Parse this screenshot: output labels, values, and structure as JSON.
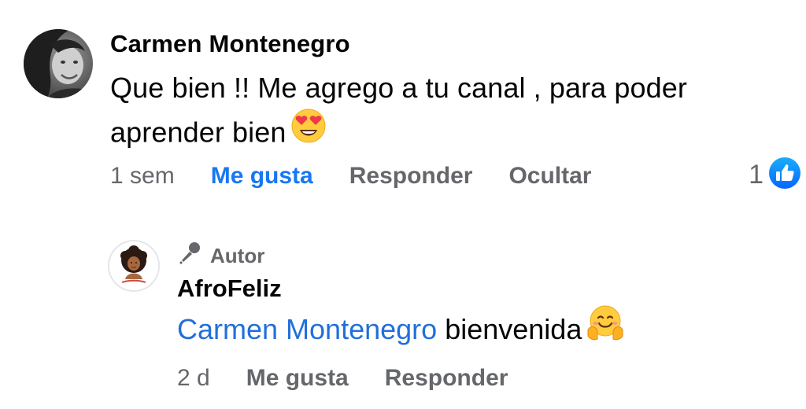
{
  "comment": {
    "author": "Carmen Montenegro",
    "text": "Que bien !! Me agrego a tu canal , para poder aprender bien",
    "emoji": "heart-eyes-emoji",
    "timestamp": "1 sem",
    "actions": {
      "like": "Me gusta",
      "reply": "Responder",
      "hide": "Ocultar"
    },
    "liked": true,
    "reaction_count": "1",
    "reaction_icon": "like-thumb-icon"
  },
  "reply": {
    "badge": "Autor",
    "badge_icon": "microphone-icon",
    "author": "AfroFeliz",
    "mention": "Carmen Montenegro",
    "text": "bienvenida",
    "emoji": "hugging-face-emoji",
    "timestamp": "2 d",
    "actions": {
      "like": "Me gusta",
      "reply": "Responder"
    }
  },
  "colors": {
    "primary_blue": "#1877f2",
    "secondary_text": "#65676b",
    "mention_blue": "#216fdb"
  }
}
